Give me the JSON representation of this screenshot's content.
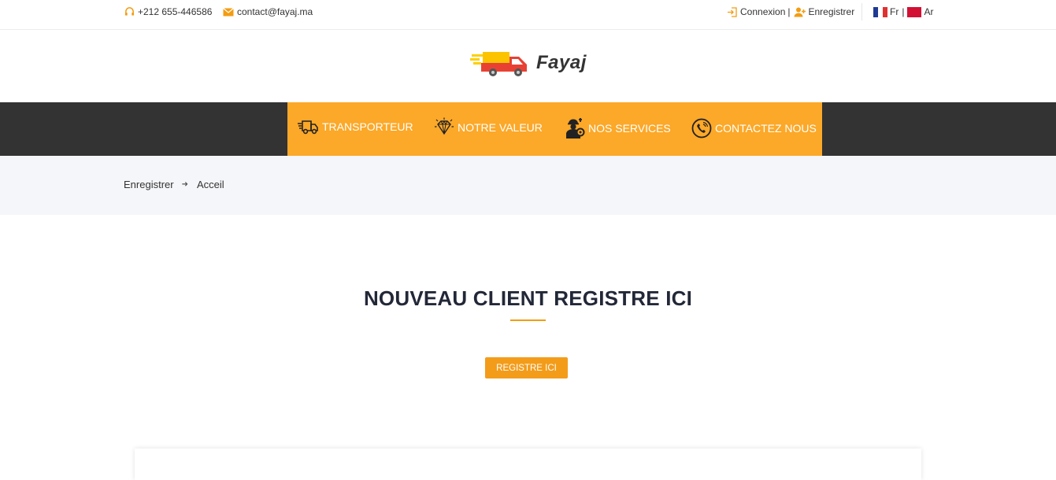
{
  "topbar": {
    "phone": "+212 655-446586",
    "email": "contact@fayaj.ma",
    "login_label": "Connexion",
    "separator": "|",
    "register_label": "Enregistrer",
    "lang_fr": "Fr",
    "lang_ar": "Ar"
  },
  "logo": {
    "text": "Fayaj"
  },
  "nav": {
    "items": [
      {
        "label": "TRANSPORTEUR",
        "icon": "truck-icon"
      },
      {
        "label": "NOTRE VALEUR",
        "icon": "diamond-icon"
      },
      {
        "label": "NOS SERVICES",
        "icon": "worker-gear-icon"
      },
      {
        "label": "CONTACTEZ NOUS",
        "icon": "phone-call-icon"
      }
    ]
  },
  "breadcrumb": {
    "current": "Enregistrer",
    "home": "Acceil"
  },
  "main": {
    "title": "NOUVEAU CLIENT REGISTRE ICI",
    "button_label": "REGISTRE ICI"
  },
  "colors": {
    "accent": "#fca828",
    "button": "#f39c1a",
    "nav_bg": "#333333",
    "title": "#232838"
  }
}
